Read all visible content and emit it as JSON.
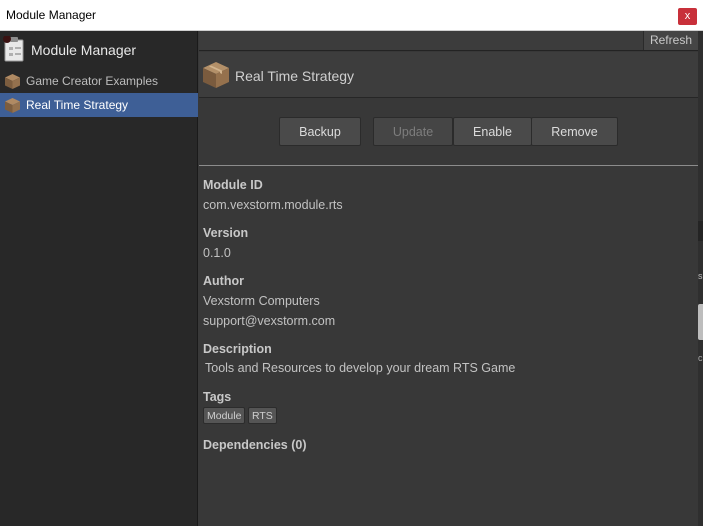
{
  "window": {
    "title": "Module Manager",
    "close_label": "x"
  },
  "sidebar": {
    "header": "Module Manager",
    "items": [
      {
        "label": "Game Creator Examples",
        "icon": "package-box-icon",
        "selected": false
      },
      {
        "label": "Real Time Strategy",
        "icon": "package-box-icon",
        "selected": true
      }
    ]
  },
  "toolbar": {
    "refresh_label": "Refresh"
  },
  "module": {
    "name": "Real Time Strategy",
    "buttons": {
      "backup": "Backup",
      "update": "Update",
      "enable": "Enable",
      "remove": "Remove"
    },
    "fields": {
      "id_label": "Module ID",
      "id_value": "com.vexstorm.module.rts",
      "version_label": "Version",
      "version_value": "0.1.0",
      "author_label": "Author",
      "author_name": "Vexstorm Computers",
      "author_email": "support@vexstorm.com",
      "description_label": "Description",
      "description_value": "Tools and Resources to develop your dream RTS Game",
      "tags_label": "Tags",
      "dependencies_label": "Dependencies (0)"
    },
    "tags": [
      "Module",
      "RTS"
    ]
  },
  "edge_glyphs": {
    "a": "s",
    "b": "c"
  },
  "colors": {
    "selection": "#3e5f96",
    "close": "#c8303a",
    "panel": "#383838",
    "sidebar": "#282828"
  }
}
